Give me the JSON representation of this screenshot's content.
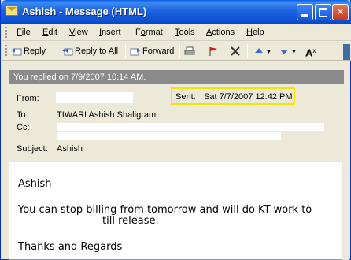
{
  "window": {
    "title": "Ashish - Message (HTML)"
  },
  "menu": {
    "items": [
      "File",
      "Edit",
      "View",
      "Insert",
      "Format",
      "Tools",
      "Actions",
      "Help"
    ],
    "underline": [
      "F",
      "E",
      "V",
      "I",
      "o",
      "T",
      "A",
      "H"
    ]
  },
  "toolbar": {
    "reply_label": "Reply",
    "reply_all_label": "Reply to All",
    "forward_label": "Forward"
  },
  "header": {
    "info_bar": "You replied on 7/9/2007 10:14 AM.",
    "from_label": "From:",
    "sent_label": "Sent:",
    "sent_value": "Sat 7/7/2007 12:42 PM",
    "to_label": "To:",
    "to_value": "TIWARI Ashish Shaligram",
    "cc_label": "Cc:",
    "subject_label": "Subject:",
    "subject_value": "Ashish"
  },
  "body": {
    "line1": "Ashish",
    "line2": "You can stop billing from tomorrow and will do KT work to",
    "line3": "till release.",
    "line4": "Thanks and Regards"
  },
  "colors": {
    "highlight": "#f2e600",
    "titlebar": "#0b4fd3"
  }
}
